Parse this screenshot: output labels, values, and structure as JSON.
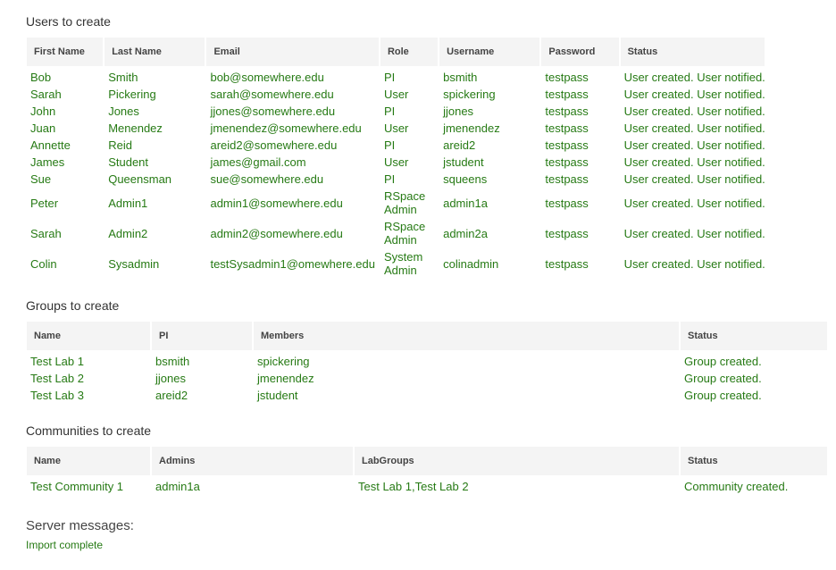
{
  "users": {
    "title": "Users to create",
    "columns": [
      "First Name",
      "Last Name",
      "Email",
      "Role",
      "Username",
      "Password",
      "Status"
    ],
    "rows": [
      {
        "first": "Bob",
        "last": "Smith",
        "email": "bob@somewhere.edu",
        "role": "PI",
        "username": "bsmith",
        "password": "testpass",
        "status": "User created. User notified."
      },
      {
        "first": "Sarah",
        "last": "Pickering",
        "email": "sarah@somewhere.edu",
        "role": "User",
        "username": "spickering",
        "password": "testpass",
        "status": "User created. User notified."
      },
      {
        "first": "John",
        "last": "Jones",
        "email": "jjones@somewhere.edu",
        "role": "PI",
        "username": "jjones",
        "password": "testpass",
        "status": "User created. User notified."
      },
      {
        "first": "Juan",
        "last": "Menendez",
        "email": "jmenendez@somewhere.edu",
        "role": "User",
        "username": "jmenendez",
        "password": "testpass",
        "status": "User created. User notified."
      },
      {
        "first": "Annette",
        "last": "Reid",
        "email": "areid2@somewhere.edu",
        "role": "PI",
        "username": "areid2",
        "password": "testpass",
        "status": "User created. User notified."
      },
      {
        "first": "James",
        "last": "Student",
        "email": "james@gmail.com",
        "role": "User",
        "username": "jstudent",
        "password": "testpass",
        "status": "User created. User notified."
      },
      {
        "first": "Sue",
        "last": "Queensman",
        "email": "sue@somewhere.edu",
        "role": "PI",
        "username": "squeens",
        "password": "testpass",
        "status": "User created. User notified."
      },
      {
        "first": "Peter",
        "last": "Admin1",
        "email": "admin1@somewhere.edu",
        "role": "RSpace Admin",
        "username": "admin1a",
        "password": "testpass",
        "status": "User created. User notified."
      },
      {
        "first": "Sarah",
        "last": "Admin2",
        "email": "admin2@somewhere.edu",
        "role": "RSpace Admin",
        "username": "admin2a",
        "password": "testpass",
        "status": "User created. User notified."
      },
      {
        "first": "Colin",
        "last": "Sysadmin",
        "email": "testSysadmin1@omewhere.edu",
        "role": "System Admin",
        "username": "colinadmin",
        "password": "testpass",
        "status": "User created. User notified."
      }
    ]
  },
  "groups": {
    "title": "Groups to create",
    "columns": [
      "Name",
      "PI",
      "Members",
      "Status"
    ],
    "rows": [
      {
        "name": "Test Lab 1",
        "pi": "bsmith",
        "members": "spickering",
        "status": "Group created."
      },
      {
        "name": "Test Lab 2",
        "pi": "jjones",
        "members": "jmenendez",
        "status": "Group created."
      },
      {
        "name": "Test Lab 3",
        "pi": "areid2",
        "members": "jstudent",
        "status": "Group created."
      }
    ]
  },
  "communities": {
    "title": "Communities to create",
    "columns": [
      "Name",
      "Admins",
      "LabGroups",
      "Status"
    ],
    "rows": [
      {
        "name": "Test Community 1",
        "admins": "admin1a",
        "labgroups": "Test Lab 1,Test Lab 2",
        "status": "Community created."
      }
    ]
  },
  "server": {
    "title": "Server messages:",
    "message": "Import complete"
  },
  "colors": {
    "value_text": "#267a14",
    "header_bg": "#f4f4f4"
  }
}
